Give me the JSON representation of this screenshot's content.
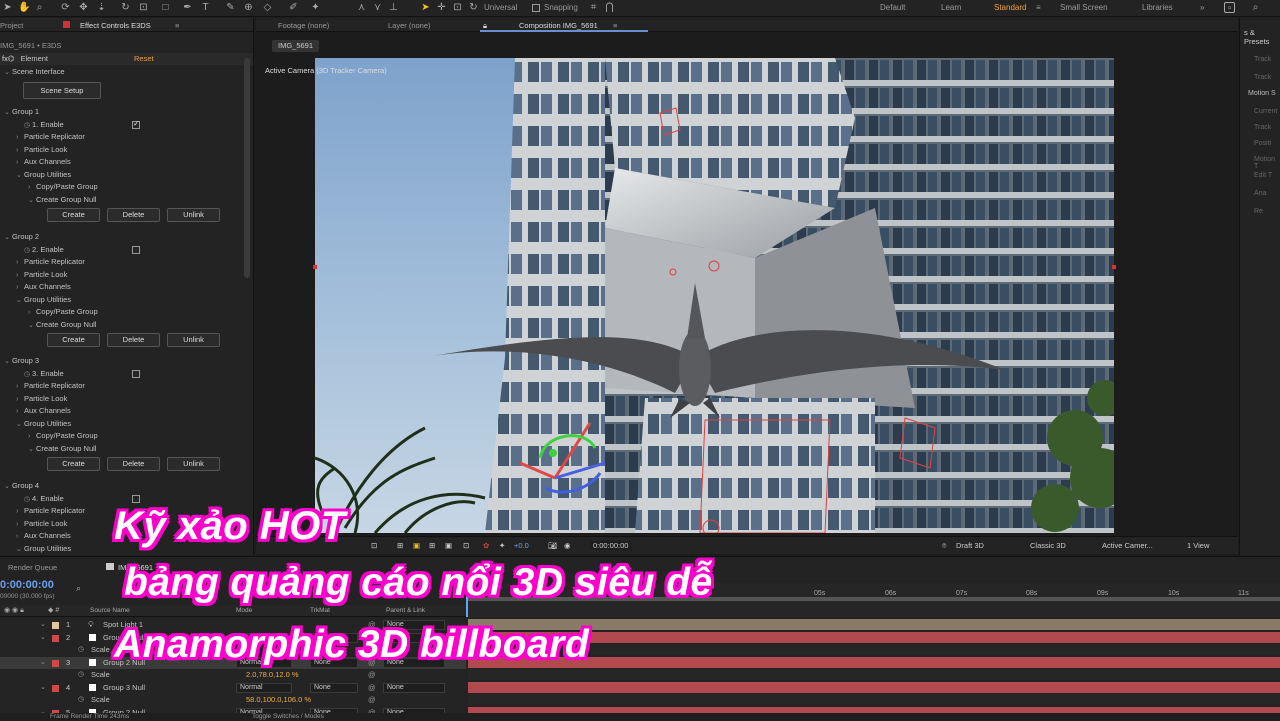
{
  "toolbar": {
    "universal_label": "Universal",
    "snapping_label": "Snapping",
    "workspaces": [
      "Default",
      "Learn",
      "Standard",
      "Small Screen",
      "Libraries"
    ],
    "active_workspace": "Standard"
  },
  "left_panel": {
    "tab_project": "Project",
    "tab_effect_controls": "Effect Controls E3DS",
    "breadcrumb": "IMG_5691 • E3DS",
    "effect_name": "Element",
    "reset_label": "Reset",
    "scene_interface": "Scene Interface",
    "scene_setup_button": "Scene Setup",
    "groups": [
      {
        "name": "Group 1",
        "enable_label": "1. Enable",
        "enabled": true
      },
      {
        "name": "Group 2",
        "enable_label": "2. Enable",
        "enabled": false
      },
      {
        "name": "Group 3",
        "enable_label": "3. Enable",
        "enabled": false
      },
      {
        "name": "Group 4",
        "enable_label": "4. Enable",
        "enabled": false
      }
    ],
    "sub_items": {
      "particle_replicator": "Particle Replicator",
      "particle_look": "Particle Look",
      "aux_channels": "Aux Channels",
      "group_utilities": "Group Utilities",
      "copy_paste_group": "Copy/Paste Group",
      "create_group_null": "Create Group Null"
    },
    "buttons": {
      "create": "Create",
      "delete": "Delete",
      "unlink": "Unlink"
    }
  },
  "composition": {
    "tab_footage": "Footage (none)",
    "tab_layer": "Layer (none)",
    "tab_composition": "Composition IMG_5691",
    "comp_chip": "IMG_5691",
    "camera_label": "Active Camera (3D Tracker Camera)",
    "viewer_controls": {
      "exposure": "+0.0",
      "timecode": "0:00:00:00",
      "renderer": "Draft 3D",
      "view_mode": "Classic 3D",
      "camera": "Active Camer...",
      "views": "1 View"
    }
  },
  "right_panel": {
    "title": "s & Presets",
    "items": [
      "Track",
      "Track",
      "Motion S",
      "Current",
      "Track",
      "Positi",
      "Motion T",
      "Edit T",
      "Ana",
      "Re"
    ]
  },
  "timeline": {
    "tab_render_queue": "Render Queue",
    "tab_comp": "IMG_5691",
    "timecode": "0:00:00:00",
    "fps_label": "00000 (30.000 fps)",
    "col_source_name": "Source Name",
    "col_mode": "Mode",
    "col_trkmat": "TrkMat",
    "col_parent": "Parent & Link",
    "ruler_ticks": [
      "05s",
      "06s",
      "07s",
      "08s",
      "09s",
      "10s",
      "11s"
    ],
    "layers": [
      {
        "num": "1",
        "name": "Spot Light 1",
        "mode": "",
        "trkmat": "",
        "parent": "None",
        "color": "#e4c49c"
      },
      {
        "num": "2",
        "name": "Group 1 Null",
        "mode": "Normal",
        "trkmat": "None",
        "parent": "None",
        "color": "#d04848"
      },
      {
        "num": "",
        "name": "Scale",
        "value": "",
        "is_prop": true
      },
      {
        "num": "3",
        "name": "Group 2 Null",
        "mode": "Normal",
        "trkmat": "None",
        "parent": "None",
        "color": "#d04848"
      },
      {
        "num": "",
        "name": "Scale",
        "value": "2.0,78.0,12.0 %",
        "is_prop": true
      },
      {
        "num": "4",
        "name": "Group 3 Null",
        "mode": "Normal",
        "trkmat": "None",
        "parent": "None",
        "color": "#d04848"
      },
      {
        "num": "",
        "name": "Scale",
        "value": "58.0,100.0,106.0 %",
        "is_prop": true
      },
      {
        "num": "5",
        "name": "Group 2 Null",
        "mode": "Normal",
        "trkmat": "None",
        "parent": "None",
        "color": "#d04848"
      }
    ],
    "footer_left": "Frame Render Time 243ms",
    "footer_mid": "Toggle Switches / Modes"
  },
  "overlay_text": {
    "line1": "Kỹ xảo HOT",
    "line2": "bảng quảng cáo nổi 3D siêu dễ",
    "line3": "Anamorphic 3D billboard",
    "stroke_color": "#ff00cc"
  }
}
